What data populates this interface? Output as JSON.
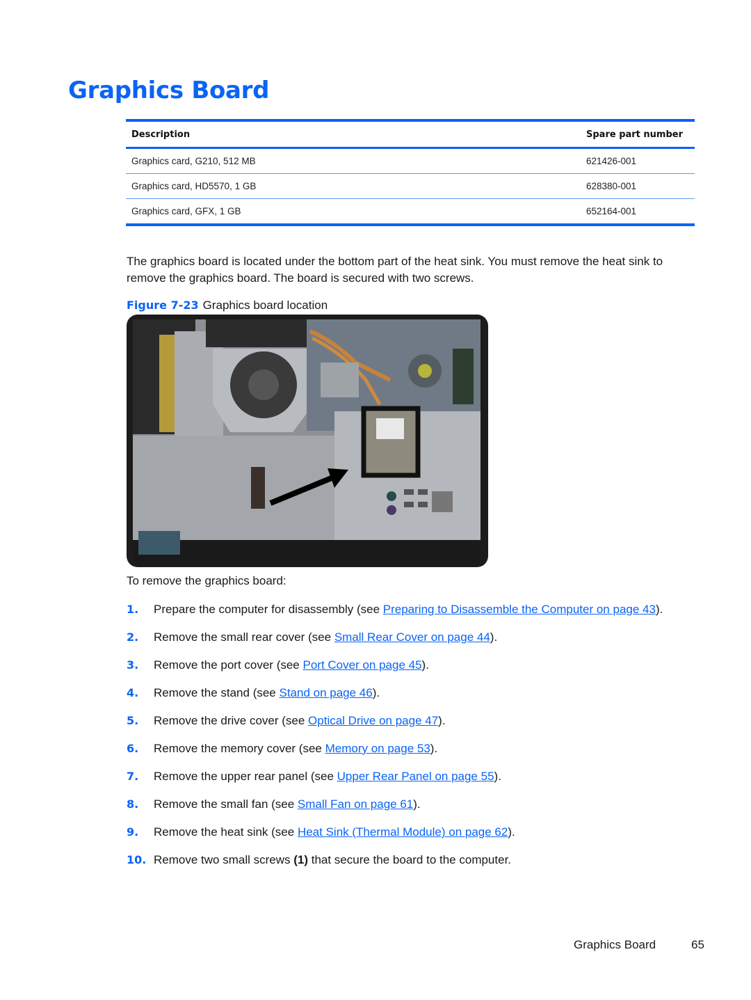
{
  "page": {
    "title": "Graphics Board",
    "accent_color": "#0a64f5"
  },
  "parts_table": {
    "headers": {
      "description": "Description",
      "part_number": "Spare part number"
    },
    "rows": [
      {
        "description": "Graphics card, G210, 512 MB",
        "part_number": "621426-001"
      },
      {
        "description": "Graphics card, HD5570, 1 GB",
        "part_number": "628380-001"
      },
      {
        "description": "Graphics card, GFX, 1 GB",
        "part_number": "652164-001"
      }
    ]
  },
  "body_paragraph": "The graphics board is located under the bottom part of the heat sink. You must remove the heat sink to remove the graphics board. The board is secured with two screws.",
  "figure": {
    "label": "Figure 7-23",
    "title": "Graphics board location",
    "image_description": "Rear view of the computer chassis with the graphics board highlighted by a black rectangle and indicated by a black arrow"
  },
  "procedure": {
    "intro": "To remove the graphics board:",
    "steps": [
      {
        "num": "1.",
        "before": "Prepare the computer for disassembly (see ",
        "link": "Preparing to Disassemble the Computer on page 43",
        "after": ")."
      },
      {
        "num": "2.",
        "before": "Remove the small rear cover (see ",
        "link": "Small Rear Cover on page 44",
        "after": ")."
      },
      {
        "num": "3.",
        "before": "Remove the port cover (see ",
        "link": "Port Cover on page 45",
        "after": ")."
      },
      {
        "num": "4.",
        "before": "Remove the stand (see ",
        "link": "Stand on page 46",
        "after": ")."
      },
      {
        "num": "5.",
        "before": "Remove the drive cover (see ",
        "link": "Optical Drive on page 47",
        "after": ")."
      },
      {
        "num": "6.",
        "before": "Remove the memory cover (see ",
        "link": "Memory on page 53",
        "after": ")."
      },
      {
        "num": "7.",
        "before": "Remove the upper rear panel (see ",
        "link": "Upper Rear Panel on page 55",
        "after": ")."
      },
      {
        "num": "8.",
        "before": "Remove the small fan (see ",
        "link": "Small Fan on page 61",
        "after": ")."
      },
      {
        "num": "9.",
        "before": "Remove the heat sink (see ",
        "link": "Heat Sink (Thermal Module) on page 62",
        "after": ")."
      },
      {
        "num": "10.",
        "before": "Remove two small screws ",
        "callout": "(1)",
        "after": " that secure the board to the computer."
      }
    ]
  },
  "footer": {
    "section_title": "Graphics Board",
    "page_number": "65"
  }
}
